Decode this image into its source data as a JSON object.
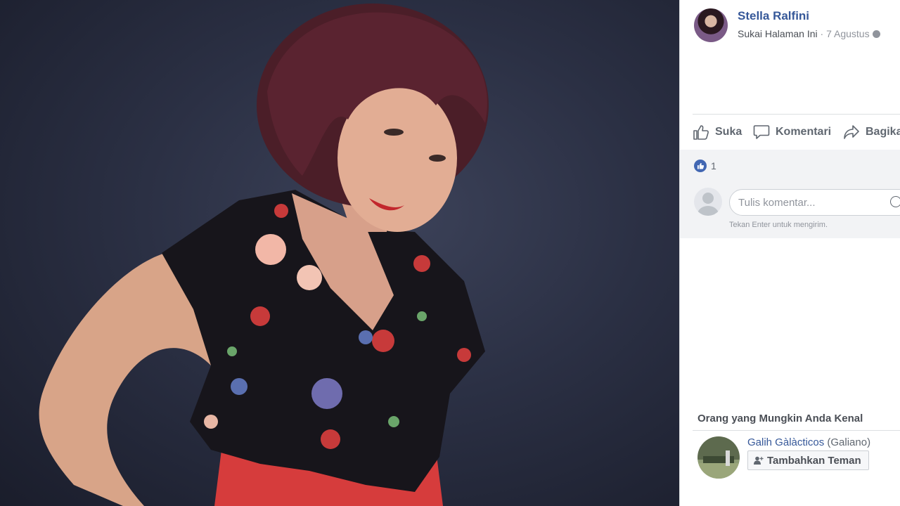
{
  "post": {
    "author": "Stella Ralfini",
    "like_page": "Sukai Halaman Ini",
    "separator": " · ",
    "date": "7 Agustus",
    "privacy_icon": "globe-icon"
  },
  "actions": {
    "like": "Suka",
    "comment": "Komentari",
    "share": "Bagikan"
  },
  "reactions": {
    "like_count": "1"
  },
  "comment_box": {
    "placeholder": "Tulis komentar...",
    "hint": "Tekan Enter untuk mengirim."
  },
  "pymk": {
    "title": "Orang yang Mungkin Anda Kenal",
    "people": [
      {
        "name": "Galih Gàlàcticos",
        "subtitle": "(Galiano)",
        "button": "Tambahkan Teman"
      }
    ]
  },
  "colors": {
    "link": "#365899",
    "like_blue": "#4267b2",
    "dress_red": "#d63c3c"
  }
}
